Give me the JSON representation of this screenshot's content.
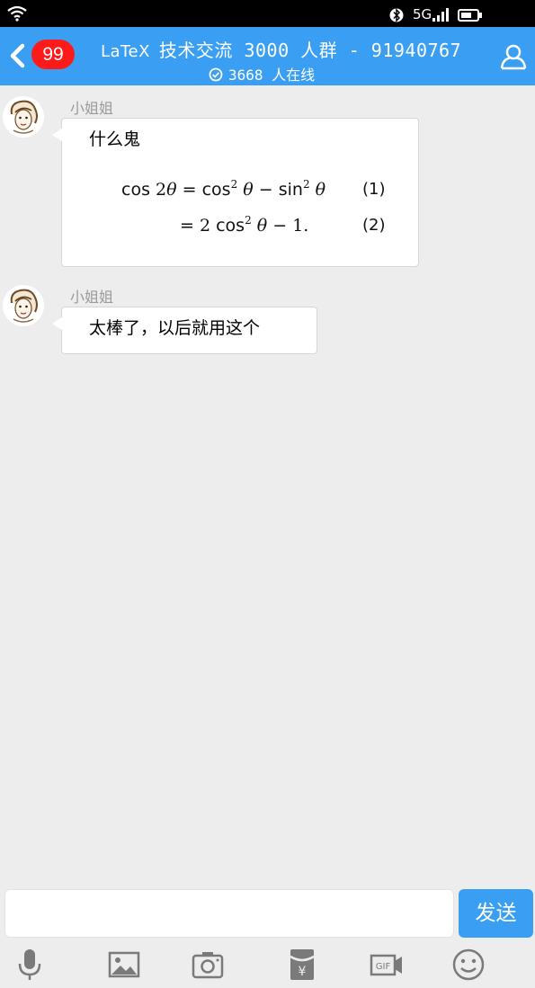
{
  "status_bar": {
    "network": "5G",
    "icons": [
      "wifi-icon",
      "bluetooth-icon",
      "signal-icon",
      "battery-icon"
    ]
  },
  "header": {
    "unread_count": "99",
    "latex_logo": "LaTeX",
    "title": "技术交流 3000 人群 - 91940767",
    "online_count": "3668",
    "online_suffix": "人在线",
    "color": "#3a9ff2"
  },
  "messages": [
    {
      "sender": "小姐姐",
      "text": "什么鬼",
      "equations": [
        {
          "tex": "cos 2θ = cos² θ − sin² θ",
          "number": "(1)"
        },
        {
          "tex": "= 2 cos² θ − 1.",
          "number": "(2)"
        }
      ]
    },
    {
      "sender": "小姐姐",
      "text": "太棒了，以后就用这个"
    }
  ],
  "composer": {
    "input_value": "",
    "send_label": "发送",
    "tools": [
      "microphone-icon",
      "image-icon",
      "camera-icon",
      "red-packet-icon",
      "gif-icon",
      "emoji-icon"
    ]
  },
  "badge_color": "#ff1a1a"
}
